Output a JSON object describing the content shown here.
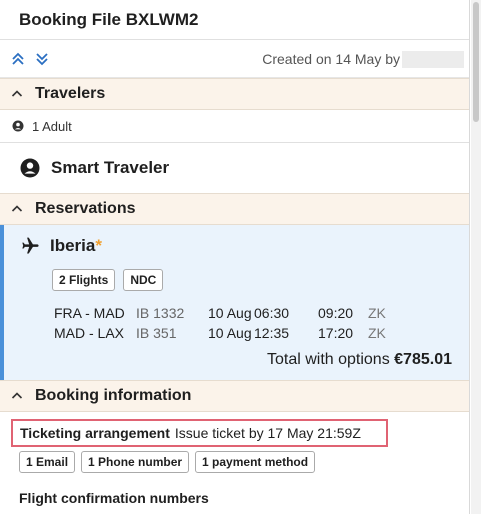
{
  "header": {
    "title": "Booking File BXLWM2"
  },
  "toolbar": {
    "created_text": "Created on 14 May by",
    "expand_all_icon": "double-chevron-up-icon",
    "collapse_all_icon": "double-chevron-down-icon"
  },
  "sections": {
    "travelers": {
      "label": "Travelers"
    },
    "reservations": {
      "label": "Reservations"
    },
    "booking_info": {
      "label": "Booking information"
    }
  },
  "travelers": {
    "count_text": "1 Adult",
    "traveler_name": "Smart Traveler"
  },
  "reservation": {
    "airline": "Iberia",
    "star": "*",
    "chips": [
      "2 Flights",
      "NDC"
    ],
    "flights": [
      {
        "route": "FRA - MAD",
        "number": "IB 1332",
        "date": "10 Aug",
        "departure": "06:30",
        "arrival": "09:20",
        "status": "ZK"
      },
      {
        "route": "MAD - LAX",
        "number": "IB 351",
        "date": "10 Aug",
        "departure": "12:35",
        "arrival": "17:20",
        "status": "ZK"
      }
    ],
    "total_label": "Total with options",
    "total_value": "€785.01"
  },
  "booking_info": {
    "ticketing_label": "Ticketing arrangement",
    "ticketing_value": "Issue ticket by 17 May 21:59Z",
    "chips": [
      "1 Email",
      "1 Phone number",
      "1 payment method"
    ],
    "confirmation_heading": "Flight confirmation numbers"
  },
  "colors": {
    "section_bg": "#fbf3ea",
    "reservation_bg": "#eaf3fc",
    "accent_blue": "#4a90d9",
    "highlight_red": "#e06373",
    "star_orange": "#f0a030"
  }
}
